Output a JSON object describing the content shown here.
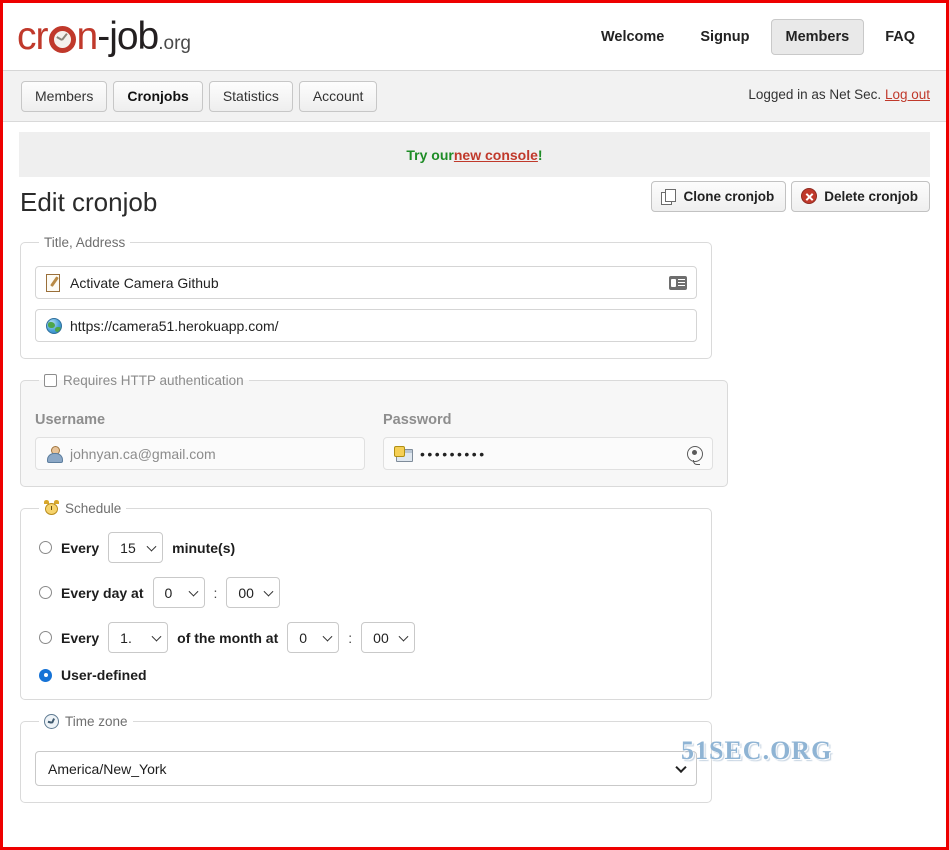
{
  "brand": {
    "name_part1": "cr",
    "name_part2": "n",
    "name_part3": "-job",
    "tld": ".org"
  },
  "topnav": {
    "items": [
      {
        "label": "Welcome",
        "active": false
      },
      {
        "label": "Signup",
        "active": false
      },
      {
        "label": "Members",
        "active": true
      },
      {
        "label": "FAQ",
        "active": false
      }
    ]
  },
  "subnav": {
    "tabs": [
      {
        "label": "Members",
        "active": false
      },
      {
        "label": "Cronjobs",
        "active": true
      },
      {
        "label": "Statistics",
        "active": false
      },
      {
        "label": "Account",
        "active": false
      }
    ],
    "logged_in_text": "Logged in as Net Sec.",
    "logout_label": "Log out"
  },
  "banner": {
    "prefix": "Try our ",
    "link": "new console",
    "suffix": "!"
  },
  "page": {
    "title": "Edit cronjob",
    "clone_label": "Clone cronjob",
    "delete_label": "Delete cronjob"
  },
  "title_address": {
    "legend": "Title, Address",
    "title_value": "Activate Camera Github",
    "url_value": "https://camera51.herokuapp.com/"
  },
  "http_auth": {
    "legend": "Requires HTTP authentication",
    "checked": false,
    "username_label": "Username",
    "password_label": "Password",
    "username_value": "johnyan.ca@gmail.com",
    "password_value": "•••••••••"
  },
  "schedule": {
    "legend": "Schedule",
    "rows": [
      {
        "id": "every-minutes",
        "selected": false,
        "label_before": "Every",
        "value1": "15",
        "label_after": "minute(s)"
      },
      {
        "id": "every-day-at",
        "selected": false,
        "label_before": "Every day at",
        "hour": "0",
        "minute": "00",
        "separator": ":"
      },
      {
        "id": "every-month-at",
        "selected": false,
        "label_before": "Every",
        "day": "1.",
        "label_mid": "of the month at",
        "hour": "0",
        "minute": "00",
        "separator": ":"
      },
      {
        "id": "user-defined",
        "selected": true,
        "label_before": "User-defined"
      }
    ]
  },
  "timezone": {
    "legend": "Time zone",
    "value": "America/New_York"
  },
  "watermark": "51SEC.ORG",
  "colors": {
    "brand_red": "#c0392b",
    "link_red": "#c0392b",
    "banner_green": "#1e8c26",
    "radio_blue": "#1673d6",
    "border_red": "#ee0000",
    "watermark_blue": "#8fb4d4"
  }
}
